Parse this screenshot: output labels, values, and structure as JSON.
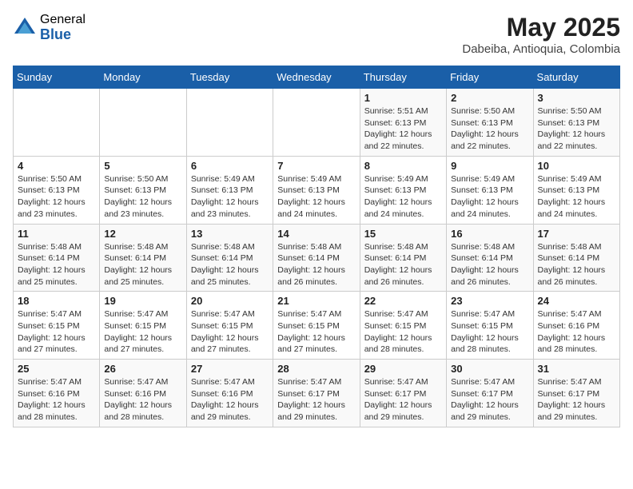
{
  "header": {
    "logo_general": "General",
    "logo_blue": "Blue",
    "month_year": "May 2025",
    "location": "Dabeiba, Antioquia, Colombia"
  },
  "days_of_week": [
    "Sunday",
    "Monday",
    "Tuesday",
    "Wednesday",
    "Thursday",
    "Friday",
    "Saturday"
  ],
  "weeks": [
    [
      {
        "day": "",
        "info": ""
      },
      {
        "day": "",
        "info": ""
      },
      {
        "day": "",
        "info": ""
      },
      {
        "day": "",
        "info": ""
      },
      {
        "day": "1",
        "info": "Sunrise: 5:51 AM\nSunset: 6:13 PM\nDaylight: 12 hours\nand 22 minutes."
      },
      {
        "day": "2",
        "info": "Sunrise: 5:50 AM\nSunset: 6:13 PM\nDaylight: 12 hours\nand 22 minutes."
      },
      {
        "day": "3",
        "info": "Sunrise: 5:50 AM\nSunset: 6:13 PM\nDaylight: 12 hours\nand 22 minutes."
      }
    ],
    [
      {
        "day": "4",
        "info": "Sunrise: 5:50 AM\nSunset: 6:13 PM\nDaylight: 12 hours\nand 23 minutes."
      },
      {
        "day": "5",
        "info": "Sunrise: 5:50 AM\nSunset: 6:13 PM\nDaylight: 12 hours\nand 23 minutes."
      },
      {
        "day": "6",
        "info": "Sunrise: 5:49 AM\nSunset: 6:13 PM\nDaylight: 12 hours\nand 23 minutes."
      },
      {
        "day": "7",
        "info": "Sunrise: 5:49 AM\nSunset: 6:13 PM\nDaylight: 12 hours\nand 24 minutes."
      },
      {
        "day": "8",
        "info": "Sunrise: 5:49 AM\nSunset: 6:13 PM\nDaylight: 12 hours\nand 24 minutes."
      },
      {
        "day": "9",
        "info": "Sunrise: 5:49 AM\nSunset: 6:13 PM\nDaylight: 12 hours\nand 24 minutes."
      },
      {
        "day": "10",
        "info": "Sunrise: 5:49 AM\nSunset: 6:13 PM\nDaylight: 12 hours\nand 24 minutes."
      }
    ],
    [
      {
        "day": "11",
        "info": "Sunrise: 5:48 AM\nSunset: 6:14 PM\nDaylight: 12 hours\nand 25 minutes."
      },
      {
        "day": "12",
        "info": "Sunrise: 5:48 AM\nSunset: 6:14 PM\nDaylight: 12 hours\nand 25 minutes."
      },
      {
        "day": "13",
        "info": "Sunrise: 5:48 AM\nSunset: 6:14 PM\nDaylight: 12 hours\nand 25 minutes."
      },
      {
        "day": "14",
        "info": "Sunrise: 5:48 AM\nSunset: 6:14 PM\nDaylight: 12 hours\nand 26 minutes."
      },
      {
        "day": "15",
        "info": "Sunrise: 5:48 AM\nSunset: 6:14 PM\nDaylight: 12 hours\nand 26 minutes."
      },
      {
        "day": "16",
        "info": "Sunrise: 5:48 AM\nSunset: 6:14 PM\nDaylight: 12 hours\nand 26 minutes."
      },
      {
        "day": "17",
        "info": "Sunrise: 5:48 AM\nSunset: 6:14 PM\nDaylight: 12 hours\nand 26 minutes."
      }
    ],
    [
      {
        "day": "18",
        "info": "Sunrise: 5:47 AM\nSunset: 6:15 PM\nDaylight: 12 hours\nand 27 minutes."
      },
      {
        "day": "19",
        "info": "Sunrise: 5:47 AM\nSunset: 6:15 PM\nDaylight: 12 hours\nand 27 minutes."
      },
      {
        "day": "20",
        "info": "Sunrise: 5:47 AM\nSunset: 6:15 PM\nDaylight: 12 hours\nand 27 minutes."
      },
      {
        "day": "21",
        "info": "Sunrise: 5:47 AM\nSunset: 6:15 PM\nDaylight: 12 hours\nand 27 minutes."
      },
      {
        "day": "22",
        "info": "Sunrise: 5:47 AM\nSunset: 6:15 PM\nDaylight: 12 hours\nand 28 minutes."
      },
      {
        "day": "23",
        "info": "Sunrise: 5:47 AM\nSunset: 6:15 PM\nDaylight: 12 hours\nand 28 minutes."
      },
      {
        "day": "24",
        "info": "Sunrise: 5:47 AM\nSunset: 6:16 PM\nDaylight: 12 hours\nand 28 minutes."
      }
    ],
    [
      {
        "day": "25",
        "info": "Sunrise: 5:47 AM\nSunset: 6:16 PM\nDaylight: 12 hours\nand 28 minutes."
      },
      {
        "day": "26",
        "info": "Sunrise: 5:47 AM\nSunset: 6:16 PM\nDaylight: 12 hours\nand 28 minutes."
      },
      {
        "day": "27",
        "info": "Sunrise: 5:47 AM\nSunset: 6:16 PM\nDaylight: 12 hours\nand 29 minutes."
      },
      {
        "day": "28",
        "info": "Sunrise: 5:47 AM\nSunset: 6:17 PM\nDaylight: 12 hours\nand 29 minutes."
      },
      {
        "day": "29",
        "info": "Sunrise: 5:47 AM\nSunset: 6:17 PM\nDaylight: 12 hours\nand 29 minutes."
      },
      {
        "day": "30",
        "info": "Sunrise: 5:47 AM\nSunset: 6:17 PM\nDaylight: 12 hours\nand 29 minutes."
      },
      {
        "day": "31",
        "info": "Sunrise: 5:47 AM\nSunset: 6:17 PM\nDaylight: 12 hours\nand 29 minutes."
      }
    ]
  ]
}
